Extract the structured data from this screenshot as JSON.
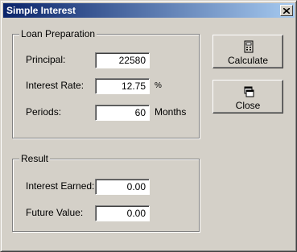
{
  "window": {
    "title": "Simple Interest",
    "close_glyph": "✕"
  },
  "loan": {
    "group_title": "Loan Preparation",
    "principal_label": "Principal:",
    "principal_value": "22580",
    "rate_label": "Interest Rate:",
    "rate_value": "12.75",
    "rate_unit": "%",
    "periods_label": "Periods:",
    "periods_value": "60",
    "periods_unit": "Months"
  },
  "result": {
    "group_title": "Result",
    "earned_label": "Interest Earned:",
    "earned_value": "0.00",
    "future_label": "Future Value:",
    "future_value": "0.00"
  },
  "buttons": {
    "calculate_label": "Calculate",
    "calculate_icon": "calculator-icon",
    "close_label": "Close",
    "close_icon": "windows-icon"
  },
  "colors": {
    "title_start": "#0a246a",
    "title_end": "#a6caf0",
    "face": "#d4d0c8"
  }
}
